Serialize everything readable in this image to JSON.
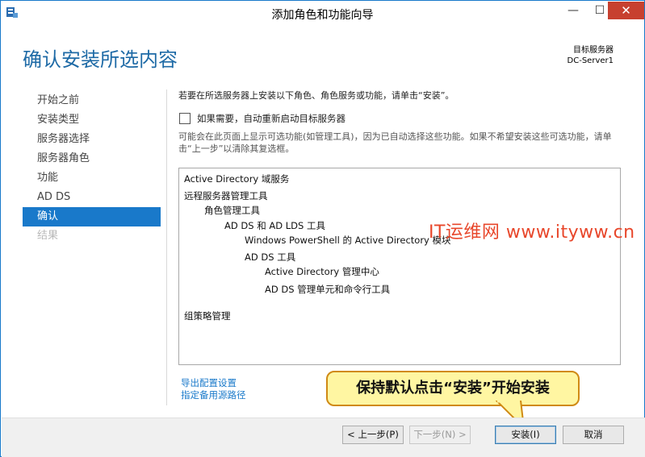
{
  "window": {
    "title": "添加角色和功能向导",
    "min_glyph": "—",
    "max_glyph": "☐",
    "close_glyph": "✕"
  },
  "header": {
    "page_title": "确认安装所选内容",
    "server_label": "目标服务器",
    "server_name": "DC-Server1"
  },
  "nav": {
    "items": [
      {
        "label": "开始之前",
        "state": "normal"
      },
      {
        "label": "安装类型",
        "state": "normal"
      },
      {
        "label": "服务器选择",
        "state": "normal"
      },
      {
        "label": "服务器角色",
        "state": "normal"
      },
      {
        "label": "功能",
        "state": "normal"
      },
      {
        "label": "AD DS",
        "state": "normal"
      },
      {
        "label": "确认",
        "state": "active"
      },
      {
        "label": "结果",
        "state": "disabled"
      }
    ]
  },
  "content": {
    "intro": "若要在所选服务器上安装以下角色、角色服务或功能，请单击“安装”。",
    "restart_checkbox_label": "如果需要，自动重新启动目标服务器",
    "restart_checked": false,
    "note": "可能会在此页面上显示可选功能(如管理工具)，因为已自动选择这些功能。如果不希望安装这些可选功能，请单击“上一步”以清除其复选框。",
    "features": [
      {
        "label": "Active Directory 域服务",
        "level": 0
      },
      {
        "label": "远程服务器管理工具",
        "level": 0
      },
      {
        "label": "角色管理工具",
        "level": 1
      },
      {
        "label": "AD DS 和 AD LDS 工具",
        "level": 2
      },
      {
        "label": "Windows PowerShell 的 Active Directory 模块",
        "level": 3
      },
      {
        "label": "AD DS 工具",
        "level": 3
      },
      {
        "label": "Active Directory 管理中心",
        "level": 4
      },
      {
        "label": "AD DS 管理单元和命令行工具",
        "level": 4
      },
      {
        "label": "组策略管理",
        "level": 0
      }
    ],
    "export_link": "导出配置设置",
    "source_link": "指定备用源路径"
  },
  "overlay": {
    "watermark": "IT运维网 www.ityww.cn",
    "callout": "保持默认点击“安装”开始安装"
  },
  "buttons": {
    "prev": "< 上一步(P)",
    "next": "下一步(N) >",
    "install": "安装(I)",
    "cancel": "取消"
  },
  "colors": {
    "accent": "#1979ca",
    "close": "#c7402f",
    "callout_fill": "#fff6a2",
    "watermark": "#e8472b"
  }
}
